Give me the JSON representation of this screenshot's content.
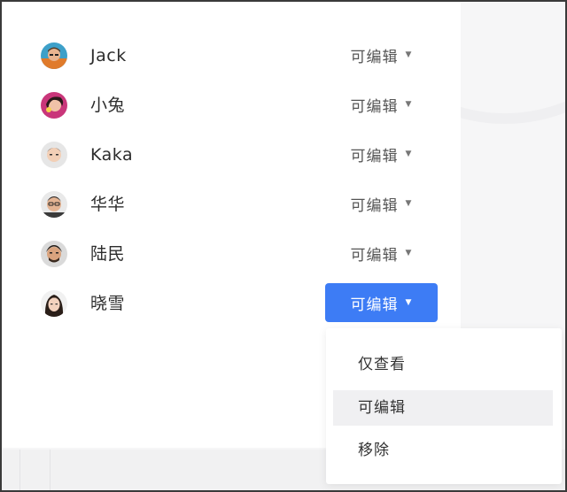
{
  "members": [
    {
      "name": "Jack",
      "permission": "可编辑",
      "avatar": "avatar-jack",
      "active": false
    },
    {
      "name": "小兔",
      "permission": "可编辑",
      "avatar": "avatar-xiaotu",
      "active": false
    },
    {
      "name": "Kaka",
      "permission": "可编辑",
      "avatar": "avatar-kaka",
      "active": false
    },
    {
      "name": "华华",
      "permission": "可编辑",
      "avatar": "avatar-huahua",
      "active": false
    },
    {
      "name": "陆民",
      "permission": "可编辑",
      "avatar": "avatar-lumin",
      "active": false
    },
    {
      "name": "晓雪",
      "permission": "可编辑",
      "avatar": "avatar-xiaoxue",
      "active": true
    }
  ],
  "caret_icon": "caret-down-icon",
  "dropdown": {
    "items": [
      {
        "label": "仅查看"
      },
      {
        "label": "可编辑",
        "highlighted": true
      },
      {
        "label": "移除"
      }
    ]
  },
  "colors": {
    "accent": "#3d7cf5",
    "hover": "#f0f0f2",
    "panel": "#ffffff",
    "background": "#f6f6f7"
  }
}
